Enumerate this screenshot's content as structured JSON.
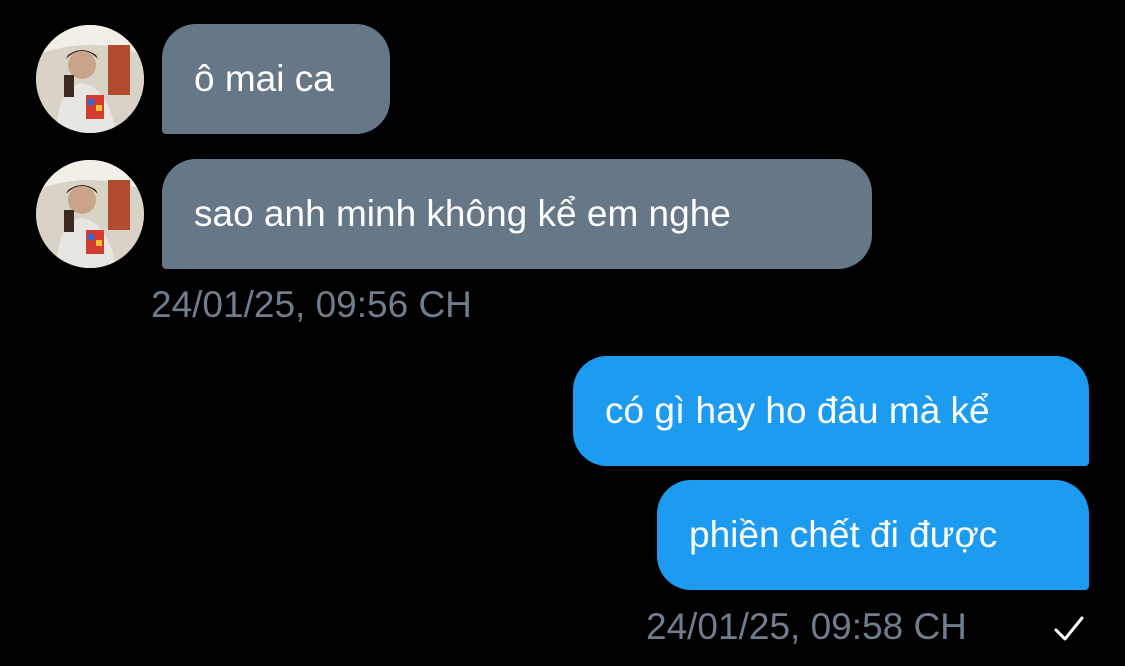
{
  "conversation": {
    "incoming": [
      {
        "text": "ô mai ca"
      },
      {
        "text": "sao anh minh không kể em nghe"
      }
    ],
    "incoming_timestamp": "24/01/25, 09:56 CH",
    "outgoing": [
      {
        "text": "có gì hay ho đâu mà kể"
      },
      {
        "text": "phiền chết đi được"
      }
    ],
    "outgoing_timestamp": "24/01/25, 09:58 CH",
    "outgoing_status_icon": "check-icon"
  },
  "colors": {
    "background": "#000000",
    "incoming_bubble": "#667788",
    "outgoing_bubble": "#1D9BF0",
    "timestamp": "#707d8c",
    "text": "#ffffff"
  }
}
